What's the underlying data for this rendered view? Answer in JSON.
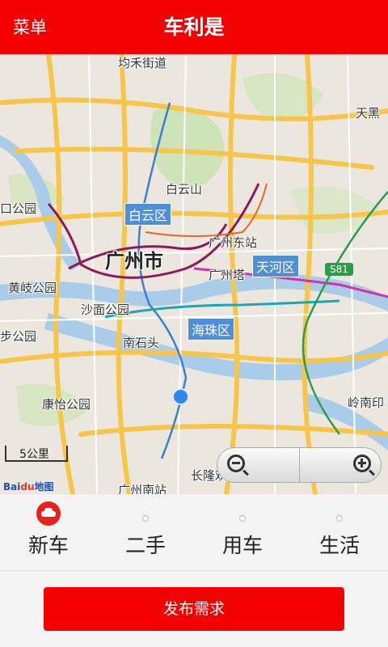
{
  "header": {
    "menu_label": "菜单",
    "title": "车利是"
  },
  "map": {
    "labels": {
      "junhe": "均禾街道",
      "baiyunshan": "白云山",
      "baiyun_district": "白云区",
      "guangzhou_city": "广州市",
      "guangzhou_east": "广州东站",
      "guangzhou_tower": "广州塔",
      "tianhe_district": "天河区",
      "tianhu": "天黑",
      "kou_park": "口公园",
      "huangqi_park": "黄岐公园",
      "shamian_park": "沙面公园",
      "nanshitou": "南石头",
      "haizhu_district": "海珠区",
      "bu_park": "步公园",
      "kangle_park": "康怡公园",
      "lingnan": "岭南印",
      "changlong": "长隆欢",
      "guangzhou_south": "广州南站"
    },
    "route_badge": "S81",
    "scale_label": "5公里",
    "brand": "Bai",
    "brand_du": "du",
    "brand_map": "地图"
  },
  "tabs": [
    {
      "label": "新车",
      "active": true
    },
    {
      "label": "二手",
      "active": false
    },
    {
      "label": "用车",
      "active": false
    },
    {
      "label": "生活",
      "active": false
    }
  ],
  "publish_button": "发布需求",
  "colors": {
    "brand_red": "#f50000",
    "district_blue": "#4f8fd6",
    "location_blue": "#2f86ee"
  }
}
